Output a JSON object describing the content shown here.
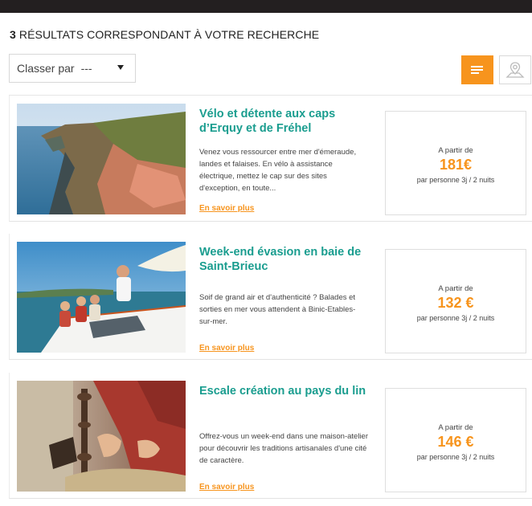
{
  "header": {
    "results_count": "3",
    "results_text": "RÉSULTATS CORRESPONDANT À VOTRE RECHERCHE"
  },
  "sort": {
    "label": "Classer par",
    "value": "---"
  },
  "view_toggle": {
    "list_icon": "list-icon",
    "map_icon": "map-pin-icon",
    "active_color": "#f7941d"
  },
  "results": [
    {
      "title": "Vélo et détente aux caps d’Erquy et de Fréhel",
      "description": "Venez vous ressourcer entre mer d'émeraude, landes et falaises. En vélo à assistance électrique, mettez le cap sur des sites d'exception, en toute...",
      "link": "En savoir plus",
      "price_from": "A partir de",
      "price": "181€",
      "price_detail": "par personne 3j / 2 nuits"
    },
    {
      "title": "Week-end évasion en baie de Saint-Brieuc",
      "description": "Soif de grand air et d'authenticité ? Balades et sorties en mer vous attendent à Binic-Etables-sur-mer.",
      "link": "En savoir plus",
      "price_from": "A partir de",
      "price": "132 €",
      "price_detail": "par personne 3j / 2 nuits"
    },
    {
      "title": "Escale création au pays du lin",
      "description": "Offrez-vous un week-end dans une maison-atelier pour découvrir les traditions artisanales d'une cité de caractère.",
      "link": "En savoir plus",
      "price_from": "A partir de",
      "price": "146 €",
      "price_detail": "par personne 3j / 2 nuits"
    }
  ],
  "colors": {
    "accent": "#f7941d",
    "title_teal": "#1a9d8f",
    "topbar": "#231f20"
  }
}
